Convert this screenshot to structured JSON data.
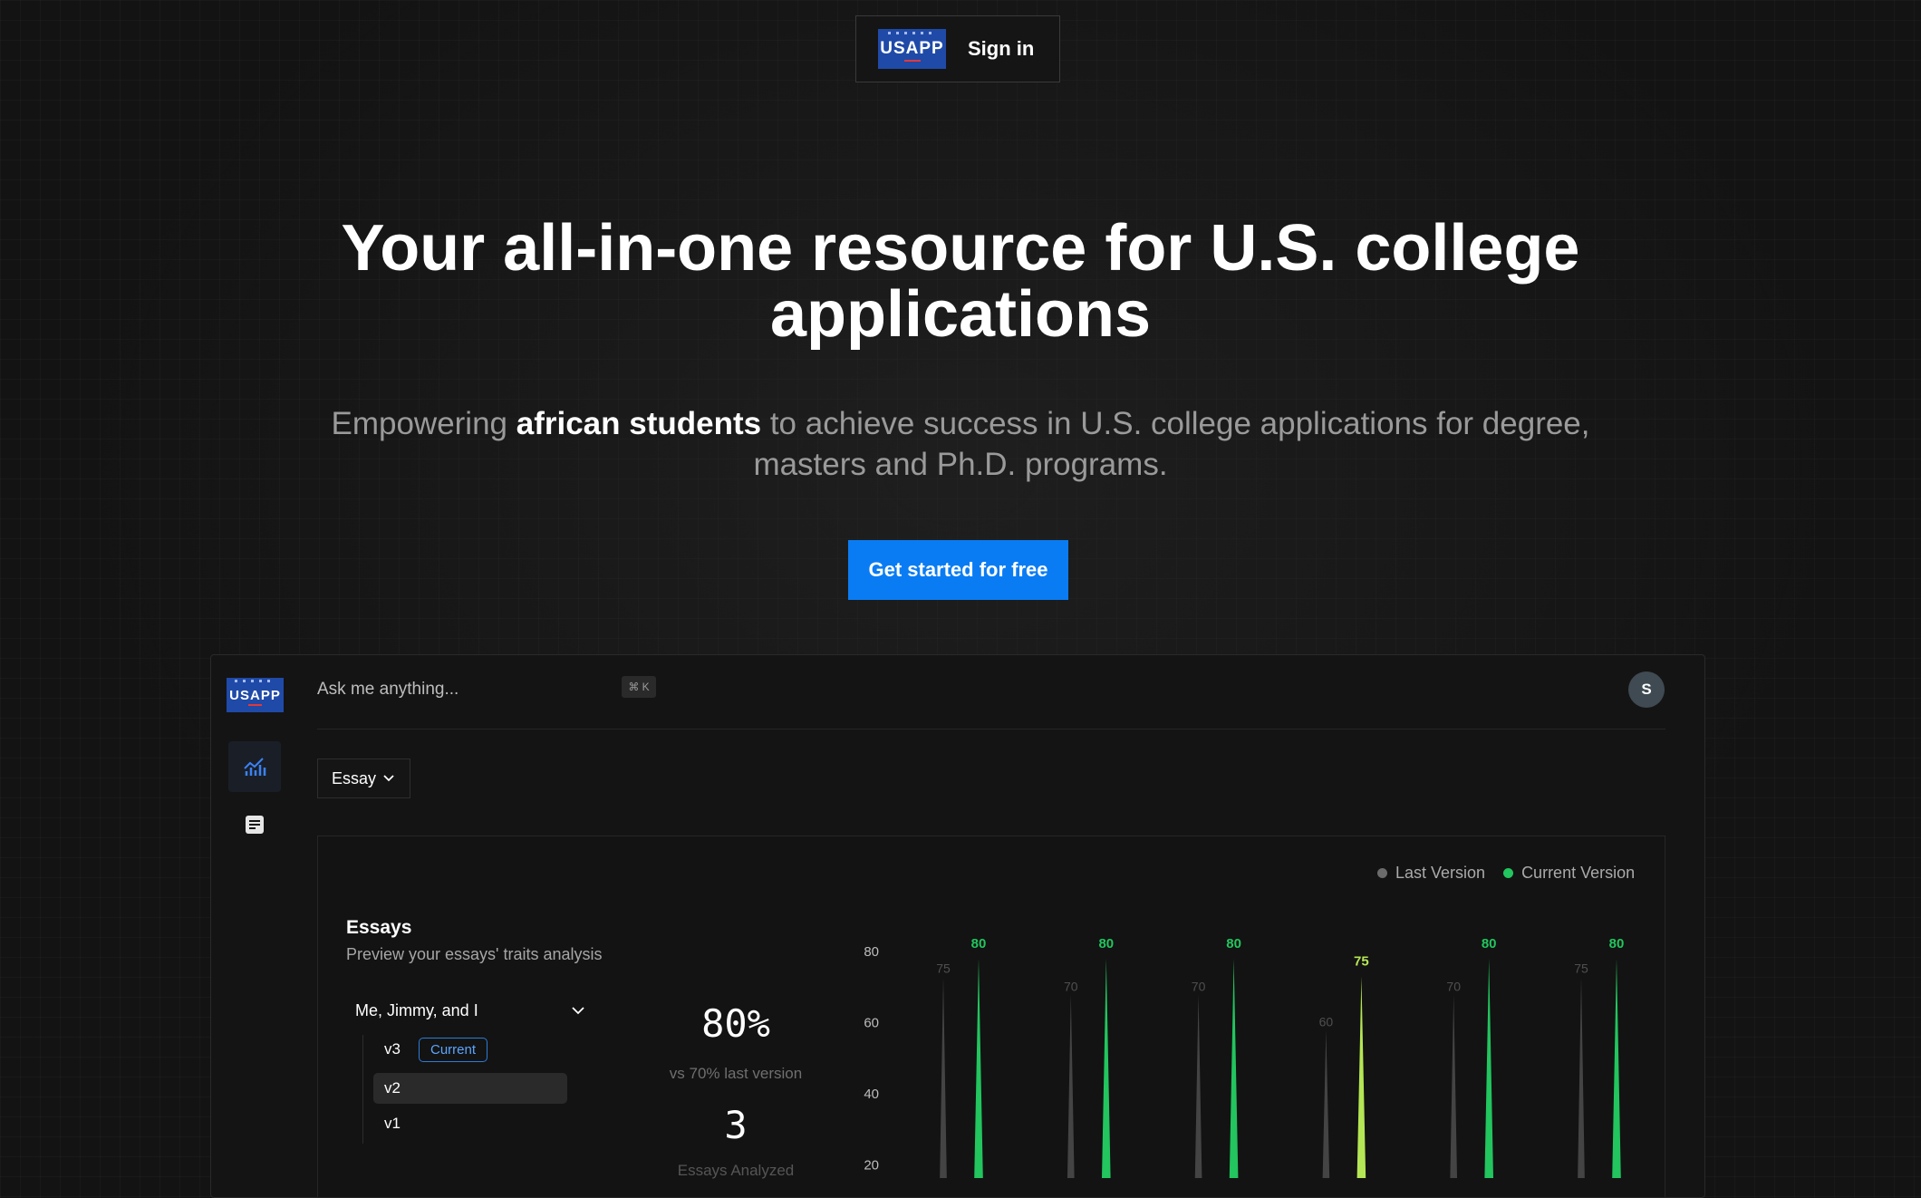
{
  "header": {
    "logo_text": "USAPP",
    "signin_label": "Sign in"
  },
  "hero": {
    "title": "Your all-in-one resource for U.S. college applications",
    "subtitle_before": "Empowering ",
    "subtitle_bold": "african students",
    "subtitle_after": " to achieve success in U.S. college applications for degree, masters and Ph.D. programs.",
    "cta_label": "Get started for free"
  },
  "dashboard": {
    "logo_text": "USAPP",
    "search_placeholder": "Ask me anything...",
    "shortcut": "⌘ K",
    "avatar_initial": "S",
    "sidebar": [
      {
        "icon": "chart-icon",
        "active": true
      },
      {
        "icon": "document-icon",
        "active": false
      }
    ],
    "filter_label": "Essay",
    "legend": {
      "last": "Last Version",
      "current": "Current Version"
    },
    "essays_title": "Essays",
    "essays_desc": "Preview your essays' traits analysis",
    "document": "Me, Jimmy, and I",
    "versions": [
      "v3",
      "v2",
      "v1"
    ],
    "current_badge": "Current",
    "score": "80%",
    "score_compare": "vs 70% last version",
    "essays_count": "3",
    "essays_count_label": "Essays Analyzed"
  },
  "colors": {
    "accent": "#0a7cf3",
    "current_version": "#22c55e",
    "last_version": "#6b6b6b",
    "highlight": "#b5e655"
  },
  "chart_data": {
    "type": "bar",
    "ylim": [
      20,
      80
    ],
    "yticks": [
      "80",
      "60",
      "40",
      "20"
    ],
    "series": [
      {
        "name": "Last Version",
        "values": [
          75,
          70,
          70,
          60,
          70,
          75
        ]
      },
      {
        "name": "Current Version",
        "values": [
          80,
          80,
          80,
          75,
          80,
          80
        ]
      }
    ]
  }
}
